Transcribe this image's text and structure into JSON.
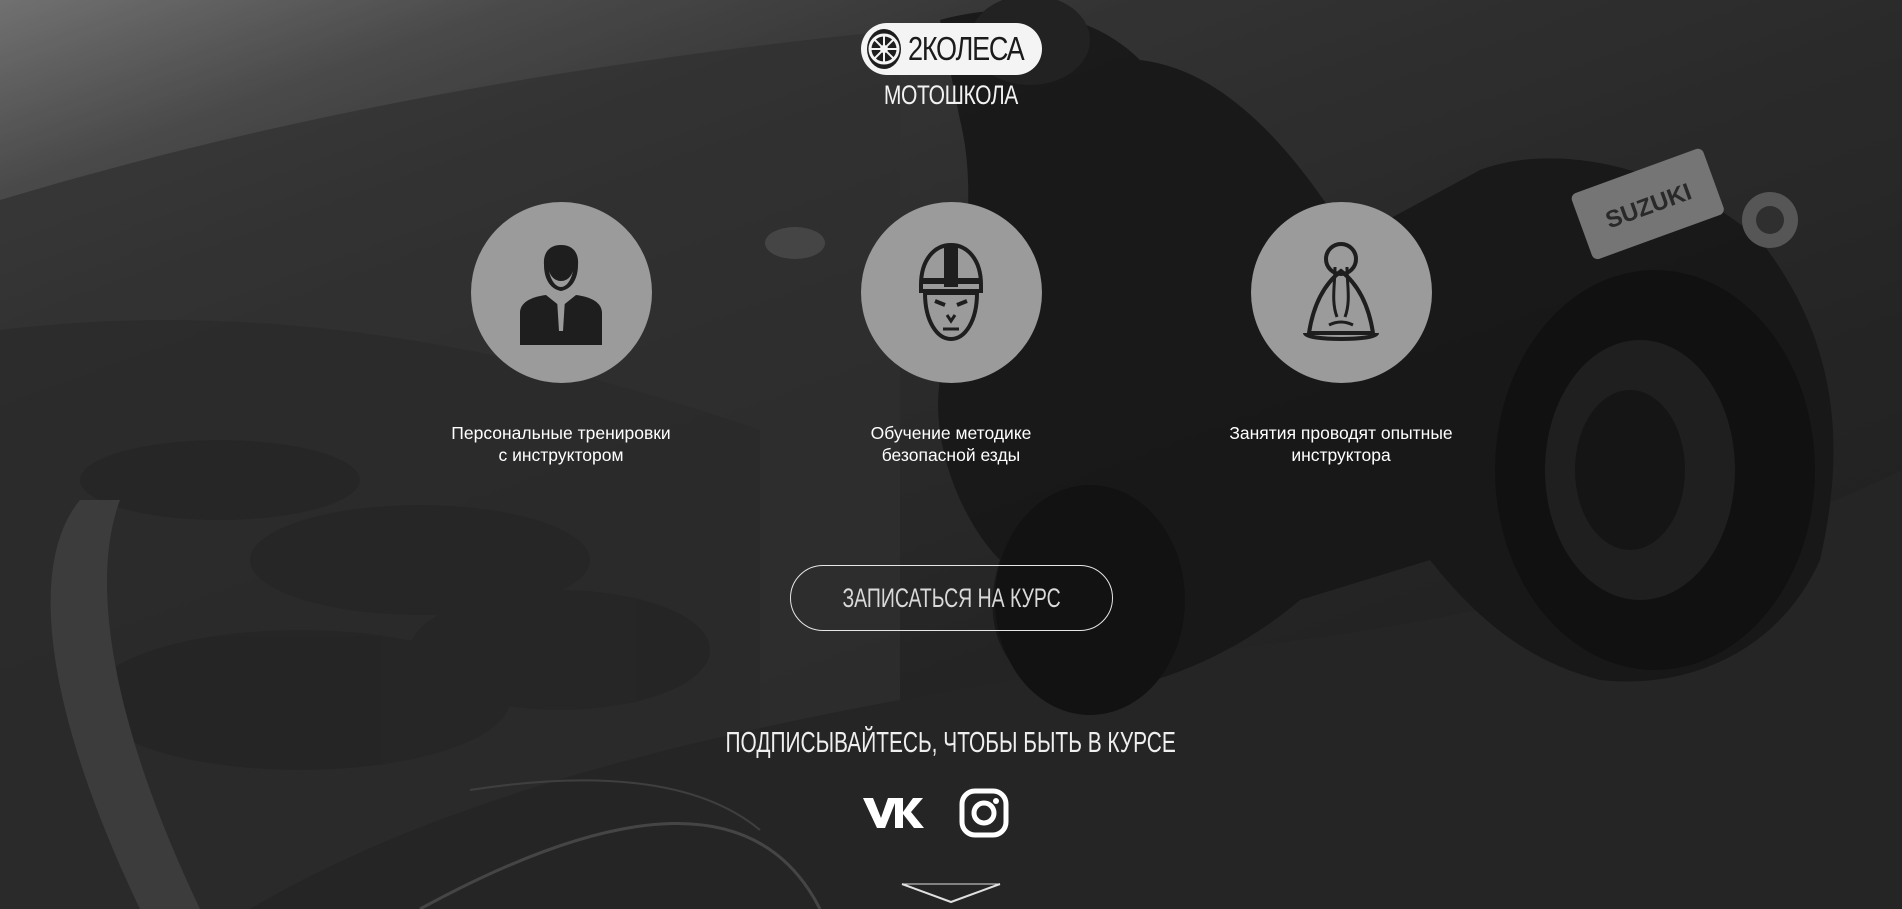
{
  "brand": {
    "logo_text": "2КОЛЕСА",
    "subtitle": "МОТОШКОЛА"
  },
  "features": [
    {
      "icon": "instructor-icon",
      "line1": "Персональные тренировки",
      "line2": "с инструктором"
    },
    {
      "icon": "helmet-rider-icon",
      "line1": "Обучение методике",
      "line2": "безопасной езды"
    },
    {
      "icon": "sage-icon",
      "line1": "Занятия проводят опытные",
      "line2": "инструктора"
    }
  ],
  "cta": {
    "label": "ЗАПИСАТЬСЯ НА КУРС"
  },
  "subscribe": {
    "text": "ПОДПИСЫВАЙТЕСЬ, ЧТОБЫ БЫТЬ В КУРСЕ"
  },
  "socials": [
    {
      "icon": "vk-icon"
    },
    {
      "icon": "instagram-icon"
    }
  ],
  "background": {
    "image_label": "SUZUKI"
  },
  "colors": {
    "circle": "#9b9b9b",
    "logo_pill": "#f4f4f4",
    "text": "#ffffff"
  }
}
